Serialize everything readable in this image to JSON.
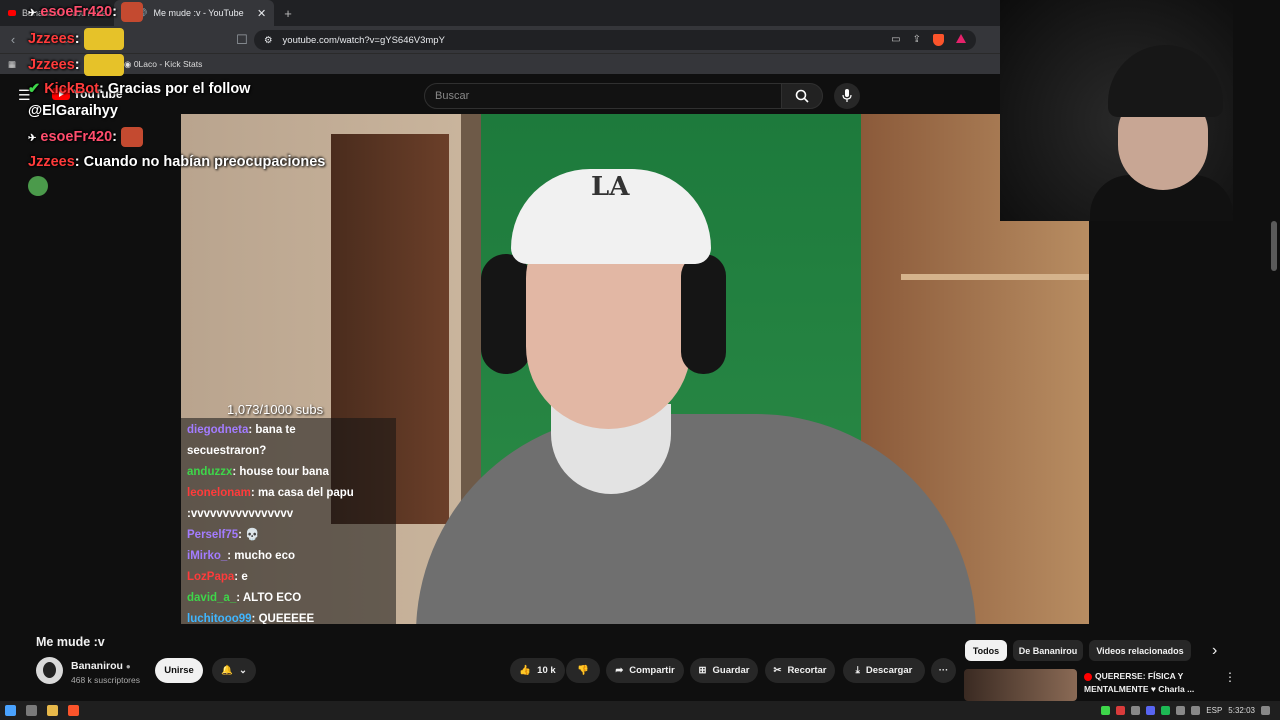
{
  "browser": {
    "tabs": [
      {
        "label": "Bananirou - YouTube",
        "active": false
      },
      {
        "label": "Me mude :v - YouTube",
        "active": true
      }
    ],
    "url": "youtube.com/watch?v=gYS646V3mpY",
    "bookmarks": [
      {
        "label": "0Laco - Kick Stats"
      }
    ]
  },
  "youtube": {
    "logo": "YouTube",
    "search_placeholder": "Buscar"
  },
  "overlay_chat": [
    {
      "user": "esoeFr420",
      "text": "",
      "color": "#ff4d6d"
    },
    {
      "user": "Jzzees",
      "text": "",
      "color": "#ff3b3b"
    },
    {
      "user": "Jzzees",
      "text": "",
      "color": "#ff3b3b"
    },
    {
      "user": "KickBot",
      "text": "Gracias por el follow",
      "color": "#ff3b3b"
    },
    {
      "user": "",
      "text": "@ElGaraihyy",
      "color": "#ffffff"
    },
    {
      "user": "esoeFr420",
      "text": "",
      "color": "#ff4d6d"
    },
    {
      "user": "Jzzees",
      "text": "Cuando no habían preocupaciones",
      "color": "#ff3b3b"
    }
  ],
  "video": {
    "subs_counter": "1,073/1000 subs",
    "cap_logo": "LA",
    "chat": [
      {
        "user": "diegodneta",
        "text": "bana te",
        "color": "#a37cff"
      },
      {
        "user": "",
        "text": "secuestraron?",
        "color": "#ffffff"
      },
      {
        "user": "anduzzx",
        "text": "house tour bana",
        "color": "#3ed64a"
      },
      {
        "user": "leonelonam",
        "text": "ma casa del papu",
        "color": "#ff3b3b"
      },
      {
        "user": "",
        "text": ":vvvvvvvvvvvvvvvv",
        "color": "#ffffff"
      },
      {
        "user": "Perself75",
        "text": "💀",
        "color": "#a37cff"
      },
      {
        "user": "iMirko_",
        "text": "mucho eco",
        "color": "#a37cff"
      },
      {
        "user": "LozPapa",
        "text": "e",
        "color": "#ff3b3b"
      },
      {
        "user": "david_a_",
        "text": "ALTO ECO",
        "color": "#3ed64a"
      },
      {
        "user": "luchitooo99",
        "text": "QUEEEEE",
        "color": "#3fb6ff"
      }
    ]
  },
  "watch": {
    "title": "Me mude :v",
    "channel": "Bananirou",
    "subscribers": "468 k suscriptores",
    "join_label": "Unirse",
    "likes": "10 k",
    "share_label": "Compartir",
    "save_label": "Guardar",
    "clip_label": "Recortar",
    "download_label": "Descargar",
    "more_label": "···"
  },
  "related": {
    "chips": [
      {
        "label": "Todos",
        "active": true
      },
      {
        "label": "De Bananirou",
        "active": false
      },
      {
        "label": "Videos relacionados",
        "active": false
      }
    ],
    "next_arrow": "›",
    "first_title": "QUERERSE: FÍSICA Y MENTALMENTE ♥ Charla ..."
  },
  "taskbar": {
    "language": "ESP",
    "time": "5:32:03"
  },
  "colors": {
    "accent": "#ff0000",
    "background": "#0f0f0f"
  }
}
